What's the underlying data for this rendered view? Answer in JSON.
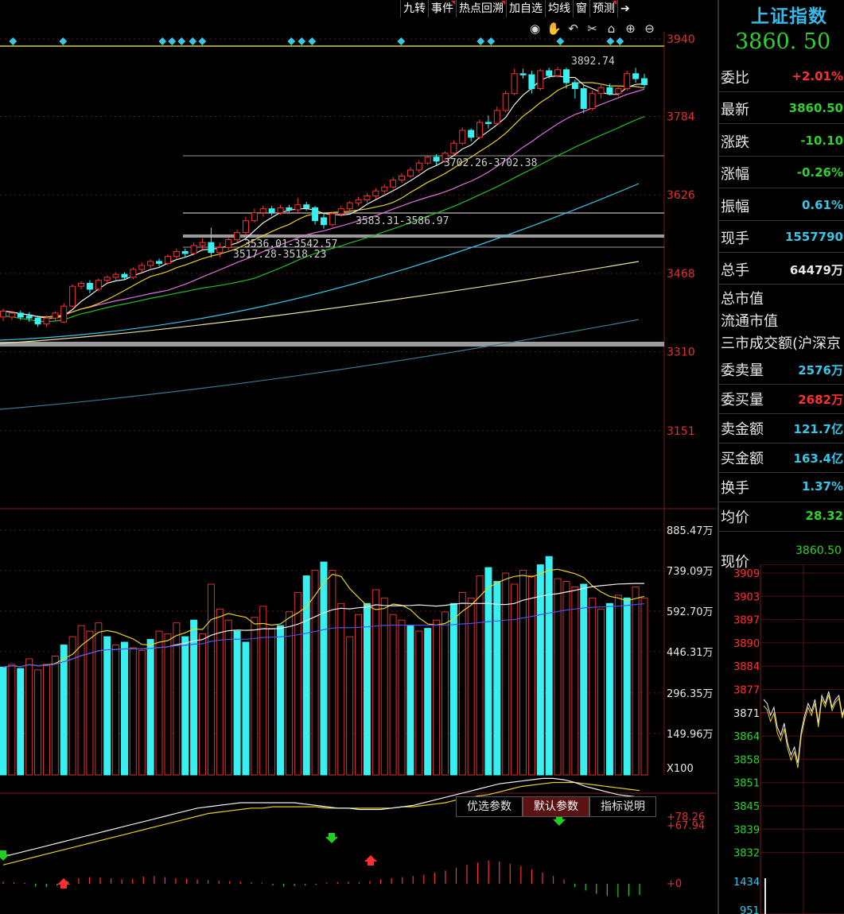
{
  "toolbar": [
    "九转",
    "事件",
    "热点回溯",
    "加自选",
    "均线",
    "窗",
    "预测"
  ],
  "toolbar_marks": [
    false,
    true,
    true,
    false,
    false,
    false,
    true
  ],
  "tools": [
    "eye-icon",
    "hand-icon",
    "undo-icon",
    "cut-icon",
    "lock-icon",
    "zoom-in-icon",
    "zoom-out-icon"
  ],
  "tool_glyphs": [
    "◉",
    "✋",
    "↶",
    "✂",
    "⌂",
    "⊕",
    "⊖"
  ],
  "panel": {
    "title": "上证指数",
    "price": "3860. 50",
    "rows": [
      {
        "label": "委比",
        "value": "+2.01%",
        "color": "#ff3030"
      },
      {
        "label": "最新",
        "value": "3860.50",
        "color": "#2fd12f"
      },
      {
        "label": "涨跌",
        "value": "-10.10",
        "color": "#2fd12f"
      },
      {
        "label": "涨幅",
        "value": "-0.26%",
        "color": "#2fd12f"
      },
      {
        "label": "振幅",
        "value": "0.61%",
        "color": "#39c6e6"
      },
      {
        "label": "现手",
        "value": "1557790",
        "color": "#39c6e6"
      },
      {
        "label": "总手",
        "value": "64479万",
        "color": "#e8e8e8"
      }
    ],
    "plain": [
      "总市值",
      "流通市值",
      "三市成交额(沪深京"
    ],
    "rows2": [
      {
        "label": "委卖量",
        "value": "2576万",
        "color": "#39c6e6"
      },
      {
        "label": "委买量",
        "value": "2682万",
        "color": "#ff3030"
      },
      {
        "label": "卖金额",
        "value": "121.7亿",
        "color": "#39c6e6"
      },
      {
        "label": "买金额",
        "value": "163.4亿",
        "color": "#39c6e6"
      },
      {
        "label": "换手",
        "value": "1.37%",
        "color": "#39c6e6"
      },
      {
        "label": "均价",
        "value": "28.32",
        "color": "#2fd12f"
      }
    ],
    "now_label": "现价",
    "now_value": "3860.50"
  },
  "tabs": [
    "优选参数",
    "默认参数",
    "指标说明"
  ],
  "active_tab": 1,
  "chart_data": [
    {
      "type": "candlestick",
      "y_ticks": [
        "3940",
        "3784",
        "3626",
        "3468",
        "3310",
        "3151"
      ],
      "ylim": [
        3060,
        3970
      ],
      "annotations": [
        "3892.74",
        "3702.26-3702.38",
        "3583.31-3586.97",
        "3536.01-3542.57",
        "3517.28-3518.23"
      ],
      "candles": [
        [
          3380,
          3392,
          3372,
          3397
        ],
        [
          3380,
          3388,
          3374,
          3392
        ],
        [
          3388,
          3380,
          3374,
          3393
        ],
        [
          3382,
          3378,
          3370,
          3390
        ],
        [
          3378,
          3366,
          3360,
          3383
        ],
        [
          3366,
          3378,
          3360,
          3383
        ],
        [
          3378,
          3388,
          3372,
          3392
        ],
        [
          3370,
          3402,
          3368,
          3408
        ],
        [
          3402,
          3442,
          3400,
          3446
        ],
        [
          3442,
          3448,
          3436,
          3452
        ],
        [
          3448,
          3436,
          3428,
          3454
        ],
        [
          3436,
          3454,
          3432,
          3458
        ],
        [
          3454,
          3460,
          3448,
          3464
        ],
        [
          3460,
          3466,
          3454,
          3470
        ],
        [
          3466,
          3460,
          3456,
          3470
        ],
        [
          3460,
          3476,
          3456,
          3480
        ],
        [
          3476,
          3484,
          3470,
          3490
        ],
        [
          3484,
          3492,
          3478,
          3496
        ],
        [
          3492,
          3488,
          3482,
          3498
        ],
        [
          3488,
          3502,
          3484,
          3506
        ],
        [
          3502,
          3512,
          3496,
          3518
        ],
        [
          3512,
          3508,
          3500,
          3518
        ],
        [
          3508,
          3524,
          3504,
          3530
        ],
        [
          3524,
          3530,
          3516,
          3538
        ],
        [
          3530,
          3510,
          3500,
          3560
        ],
        [
          3510,
          3520,
          3500,
          3530
        ],
        [
          3520,
          3536,
          3514,
          3540
        ],
        [
          3536,
          3550,
          3530,
          3556
        ],
        [
          3550,
          3574,
          3546,
          3582
        ],
        [
          3574,
          3590,
          3570,
          3598
        ],
        [
          3590,
          3598,
          3582,
          3604
        ],
        [
          3598,
          3590,
          3584,
          3604
        ],
        [
          3590,
          3600,
          3586,
          3606
        ],
        [
          3600,
          3596,
          3590,
          3606
        ],
        [
          3596,
          3606,
          3590,
          3620
        ],
        [
          3606,
          3600,
          3594,
          3612
        ],
        [
          3600,
          3574,
          3566,
          3604
        ],
        [
          3580,
          3566,
          3558,
          3590
        ],
        [
          3566,
          3588,
          3562,
          3592
        ],
        [
          3588,
          3598,
          3582,
          3604
        ],
        [
          3598,
          3610,
          3594,
          3614
        ],
        [
          3610,
          3616,
          3604,
          3622
        ],
        [
          3616,
          3624,
          3610,
          3630
        ],
        [
          3624,
          3634,
          3618,
          3640
        ],
        [
          3634,
          3642,
          3628,
          3648
        ],
        [
          3642,
          3656,
          3638,
          3662
        ],
        [
          3656,
          3664,
          3650,
          3670
        ],
        [
          3664,
          3676,
          3660,
          3682
        ],
        [
          3676,
          3690,
          3670,
          3696
        ],
        [
          3690,
          3702,
          3686,
          3706
        ],
        [
          3702,
          3694,
          3686,
          3708
        ],
        [
          3694,
          3710,
          3690,
          3714
        ],
        [
          3710,
          3730,
          3706,
          3736
        ],
        [
          3730,
          3756,
          3726,
          3762
        ],
        [
          3756,
          3742,
          3734,
          3760
        ],
        [
          3742,
          3772,
          3738,
          3778
        ],
        [
          3772,
          3770,
          3760,
          3786
        ],
        [
          3770,
          3796,
          3766,
          3804
        ],
        [
          3796,
          3830,
          3792,
          3836
        ],
        [
          3830,
          3870,
          3826,
          3880
        ],
        [
          3870,
          3868,
          3860,
          3880
        ],
        [
          3868,
          3840,
          3830,
          3876
        ],
        [
          3840,
          3876,
          3836,
          3880
        ],
        [
          3876,
          3866,
          3860,
          3882
        ],
        [
          3866,
          3878,
          3862,
          3884
        ],
        [
          3878,
          3852,
          3840,
          3882
        ],
        [
          3852,
          3840,
          3820,
          3858
        ],
        [
          3840,
          3800,
          3790,
          3848
        ],
        [
          3800,
          3830,
          3796,
          3836
        ],
        [
          3830,
          3842,
          3820,
          3850
        ],
        [
          3842,
          3830,
          3826,
          3850
        ],
        [
          3830,
          3840,
          3824,
          3846
        ],
        [
          3840,
          3870,
          3836,
          3876
        ],
        [
          3870,
          3860,
          3852,
          3882
        ],
        [
          3860,
          3848,
          3842,
          3870
        ]
      ]
    },
    {
      "type": "bar",
      "y_ticks": [
        "885.47万",
        "739.09万",
        "592.70万",
        "446.31万",
        "296.35万",
        "149.96万"
      ],
      "unit": "X100",
      "ylim": [
        0,
        885.47
      ],
      "values": [
        390,
        400,
        385,
        420,
        380,
        400,
        430,
        470,
        500,
        540,
        520,
        550,
        500,
        470,
        480,
        460,
        450,
        490,
        520,
        510,
        550,
        500,
        560,
        510,
        690,
        600,
        560,
        520,
        480,
        570,
        610,
        530,
        540,
        590,
        660,
        720,
        740,
        770,
        740,
        620,
        500,
        580,
        620,
        670,
        640,
        580,
        560,
        540,
        520,
        530,
        560,
        590,
        620,
        660,
        640,
        720,
        750,
        700,
        730,
        690,
        740,
        720,
        760,
        790,
        710,
        700,
        680,
        690,
        640,
        600,
        620,
        650,
        640,
        680,
        640
      ]
    },
    {
      "type": "line",
      "y_ticks": [
        "78.26",
        "67.94",
        "0"
      ],
      "series_dif": [
        20,
        22,
        24,
        26,
        28,
        30,
        32,
        34,
        36,
        38,
        40,
        42,
        44,
        46,
        48,
        50,
        52,
        54,
        56,
        57,
        58,
        59,
        60,
        60,
        60,
        60,
        60,
        60,
        59,
        58,
        57,
        56,
        56,
        55,
        55,
        55,
        56,
        57,
        58,
        60,
        62,
        64,
        66,
        68,
        70,
        72,
        74,
        75,
        76,
        77,
        78,
        78,
        77,
        75,
        72,
        70,
        68,
        66,
        65,
        64
      ],
      "series_dea": [
        14,
        16,
        18,
        20,
        22,
        24,
        26,
        28,
        30,
        32,
        34,
        36,
        38,
        40,
        42,
        44,
        46,
        48,
        50,
        52,
        53,
        54,
        55,
        56,
        56,
        57,
        57,
        57,
        57,
        57,
        56,
        56,
        56,
        56,
        56,
        56,
        56,
        57,
        57,
        58,
        59,
        60,
        62,
        63,
        65,
        66,
        68,
        70,
        72,
        73,
        74,
        75,
        75,
        75,
        74,
        73,
        72,
        71,
        70,
        69
      ],
      "hist": [
        0.4,
        0.3,
        0.2,
        -0.5,
        -0.6,
        -0.4,
        0.5,
        1.0,
        1.2,
        1.1,
        1.0,
        0.8,
        0.9,
        1.3,
        1.4,
        1.2,
        1.0,
        0.9,
        0.8,
        0.7,
        0.6,
        0.5,
        0.4,
        0.3,
        0.2,
        -0.3,
        -0.5,
        -0.4,
        -0.3,
        -0.2,
        0.2,
        0.3,
        0.4,
        0.3,
        0.5,
        0.8,
        1.0,
        1.2,
        1.4,
        1.6,
        2.0,
        2.4,
        2.9,
        3.4,
        3.8,
        4.2,
        4.0,
        3.6,
        3.2,
        2.6,
        2.0,
        1.4,
        0.8,
        -0.6,
        -1.2,
        -1.8,
        -2.2,
        -2.4,
        -2.2,
        -2.0
      ]
    },
    {
      "type": "line",
      "y_ticks": [
        "3909",
        "3903",
        "3897",
        "3890",
        "3884",
        "3877",
        "3871",
        "3864",
        "3858",
        "3851",
        "3845",
        "3839",
        "3832"
      ],
      "vol_ticks": [
        "1434",
        "951"
      ]
    }
  ]
}
